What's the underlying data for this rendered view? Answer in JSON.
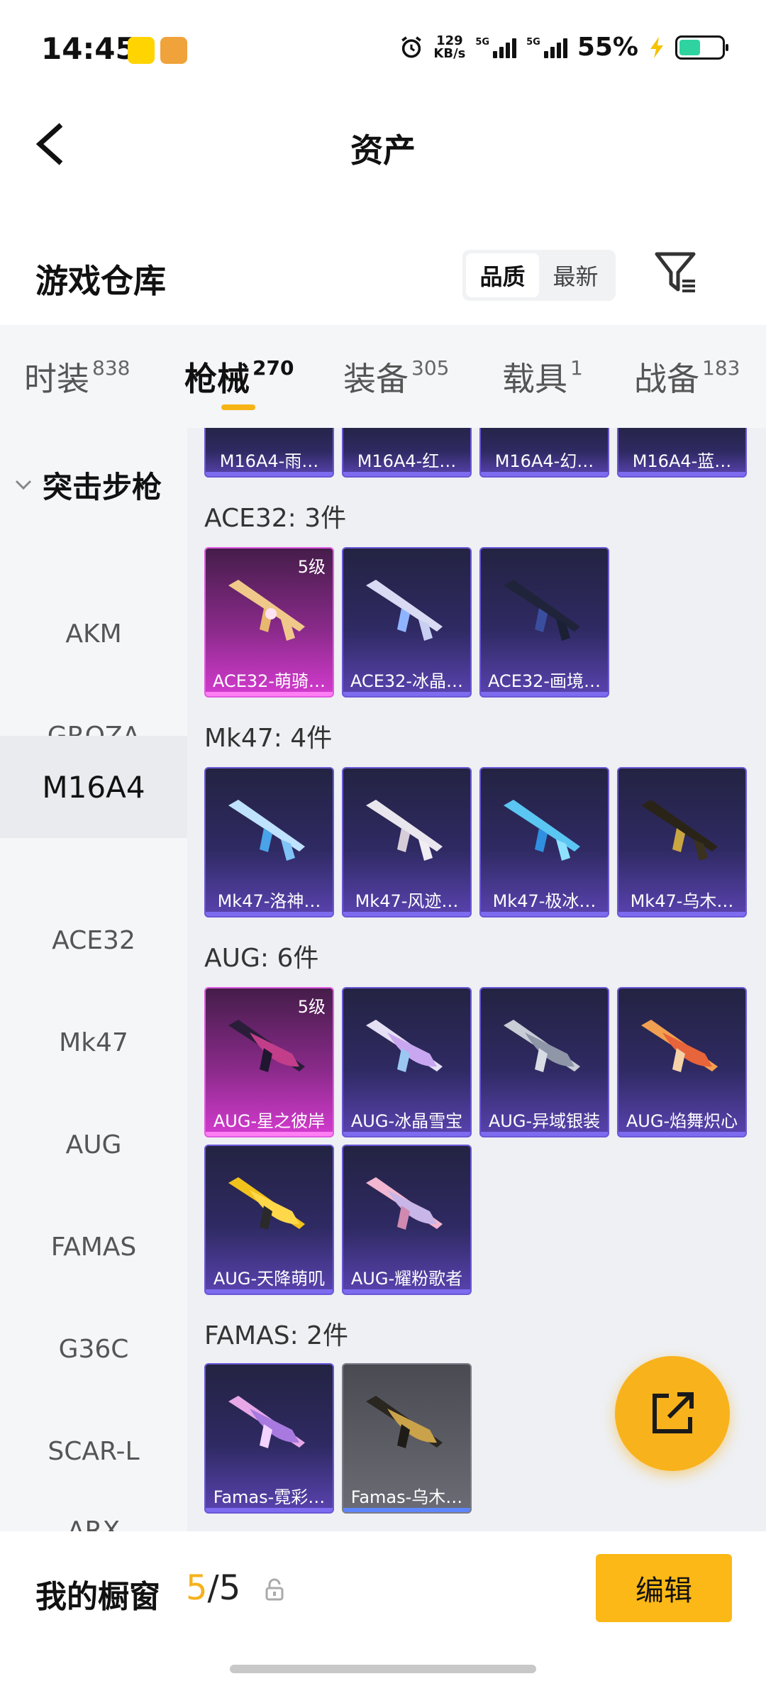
{
  "status_bar": {
    "time": "14:45",
    "net_speed_value": "129",
    "net_speed_unit": "KB/s",
    "signal_label_1": "5G",
    "signal_label_2": "5G",
    "battery_text": "55%",
    "battery_level": 0.55,
    "icons": [
      "alarm-icon",
      "signal-icon",
      "signal-icon",
      "charging-icon",
      "battery-icon"
    ]
  },
  "nav": {
    "title": "资产",
    "back_icon": "back-chevron-icon"
  },
  "section": {
    "title": "游戏仓库",
    "sort_quality": "品质",
    "sort_latest": "最新",
    "filter_icon": "filter-icon"
  },
  "tabs": [
    {
      "label": "时装",
      "count": "838"
    },
    {
      "label": "枪械",
      "count": "270"
    },
    {
      "label": "装备",
      "count": "305"
    },
    {
      "label": "载具",
      "count": "1"
    },
    {
      "label": "战备",
      "count": "183"
    }
  ],
  "sidebar": {
    "group": "突击步枪",
    "items": [
      "AKM",
      "GROZA",
      "M16A4",
      "ACE32",
      "Mk47",
      "AUG",
      "FAMAS",
      "G36C",
      "SCAR-L",
      "ARX"
    ],
    "selected": "M16A4"
  },
  "groups": {
    "m16": {
      "cards": [
        "M16A4-雨…",
        "M16A4-红…",
        "M16A4-幻…",
        "M16A4-蓝…"
      ]
    },
    "ace32": {
      "title": "ACE32: 3件",
      "cards": [
        "ACE32-萌骑…",
        "ACE32-冰晶…",
        "ACE32-画境…"
      ],
      "level": "5级"
    },
    "mk47": {
      "title": "Mk47: 4件",
      "cards": [
        "Mk47-洛神…",
        "Mk47-风迹…",
        "Mk47-极冰…",
        "Mk47-乌木…"
      ]
    },
    "aug": {
      "title": "AUG: 6件",
      "cards": [
        "AUG-星之彼岸",
        "AUG-冰晶雪宝",
        "AUG-异域银装",
        "AUG-焰舞炽心",
        "AUG-天降萌叽",
        "AUG-耀粉歌者"
      ],
      "level": "5级"
    },
    "famas": {
      "title": "FAMAS: 2件",
      "cards": [
        "Famas-霓彩…",
        "Famas-乌木…"
      ]
    }
  },
  "fab": {
    "icon": "share-icon"
  },
  "bottom": {
    "title": "我的橱窗",
    "count_current": "5",
    "count_sep": "/",
    "count_total": "5",
    "lock_icon": "lock-icon",
    "edit_label": "编辑"
  }
}
